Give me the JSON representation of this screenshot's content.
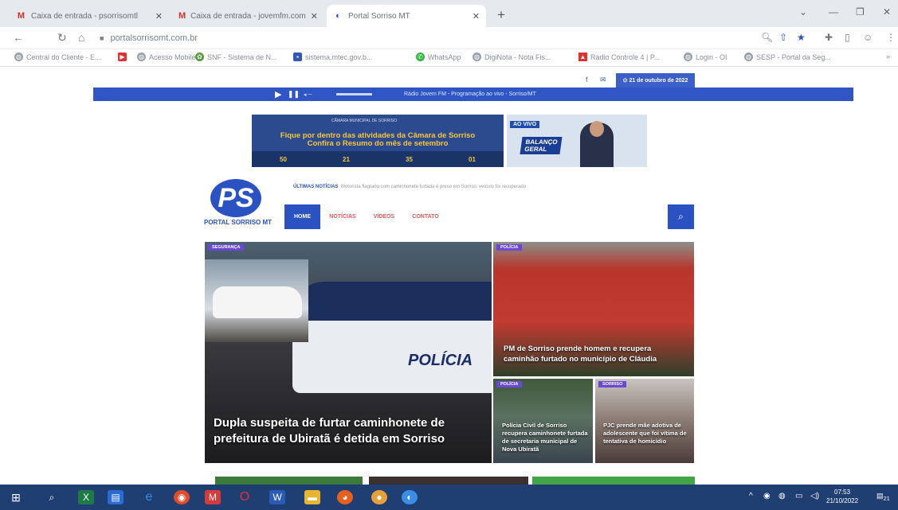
{
  "browser": {
    "tabs": [
      {
        "label": "Caixa de entrada - psorrisomtl",
        "icon": "gmail-icon"
      },
      {
        "label": "Caixa de entrada - jovemfm.com",
        "icon": "gmail-icon"
      },
      {
        "label": "Portal Sorriso MT",
        "icon": "portal-icon",
        "active": true
      }
    ],
    "new_tab": "+",
    "url": "portalsorrisomt.com.br",
    "bookmarks": [
      "Central do Cliente - E...",
      "",
      "Acesso Mobile",
      "SNF - Sistema de N...",
      "sistema.mtec.gov.b...",
      "WhatsApp",
      "DigiNota - Nota Fis...",
      "Radio Controle 4 | P...",
      "Login - OI",
      "SESP - Portal da Seg..."
    ],
    "more": "»"
  },
  "site": {
    "date": "21 de outubro de 2022",
    "social": [
      "f",
      "✉"
    ],
    "radio_text": "Rádio Jovem FM - Programação ao vivo - Sorriso/MT",
    "banner": {
      "top": "CÂMARA MUNICIPAL DE SORRISO",
      "line1": "Fique por dentro das atividades da Câmara de Sorriso",
      "line2": "Confira o Resumo do mês de setembro",
      "strip": [
        "50",
        "21",
        "35",
        "01"
      ]
    },
    "ad2": {
      "live": "AO VIVO",
      "title1": "BALANÇO",
      "title2": "GERAL"
    },
    "logo": {
      "mark": "PS",
      "name": "PORTAL SORRISO MT"
    },
    "latest_label": "ÚLTIMAS NOTÍCIAS",
    "latest_text": "Motorista flagrado com caminhonete furtada é preso em Sorriso; veículo foi recuperado",
    "nav": [
      "HOME",
      "NOTÍCIAS",
      "VÍDEOS",
      "CONTATO"
    ],
    "news": {
      "main": {
        "cat": "SEGURANÇA",
        "title": "Dupla suspeita de furtar caminhonete de prefeitura de Ubiratã é detida em Sorriso"
      },
      "c1": {
        "cat": "POLÍCIA",
        "title": "PM de Sorriso prende homem e recupera caminhão furtado no município de Cláudia"
      },
      "c2": {
        "cat": "POLÍCIA",
        "title": "Polícia Civil de Sorriso recupera caminhonete furtada de secretaria municipal de Nova Ubiratã"
      },
      "c3": {
        "cat": "SORRISO",
        "title": "PJC prende mãe adotiva de adolescente que foi vítima de tentativa de homicídio"
      }
    }
  },
  "taskbar": {
    "time": "07:53",
    "date": "21/10/2022",
    "notif": "21"
  }
}
